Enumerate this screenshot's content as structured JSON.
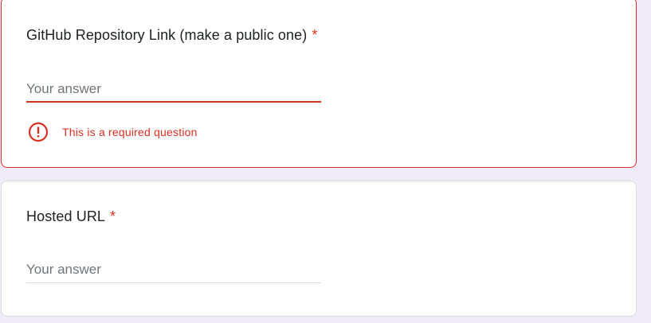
{
  "colors": {
    "page_background": "#f0ebf8",
    "error": "#d93025",
    "required_star": "#d93025",
    "title_text": "#202124",
    "placeholder_text": "#70757a",
    "divider": "#dadce0"
  },
  "questions": [
    {
      "title": "GitHub Repository Link (make a public one)",
      "required_mark": "*",
      "placeholder": "Your answer",
      "value": "",
      "state": "error",
      "error_icon": "error-exclamation-circle-icon",
      "error_message": "This is a required question"
    },
    {
      "title": "Hosted URL",
      "required_mark": "*",
      "placeholder": "Your answer",
      "value": "",
      "state": "normal"
    }
  ]
}
